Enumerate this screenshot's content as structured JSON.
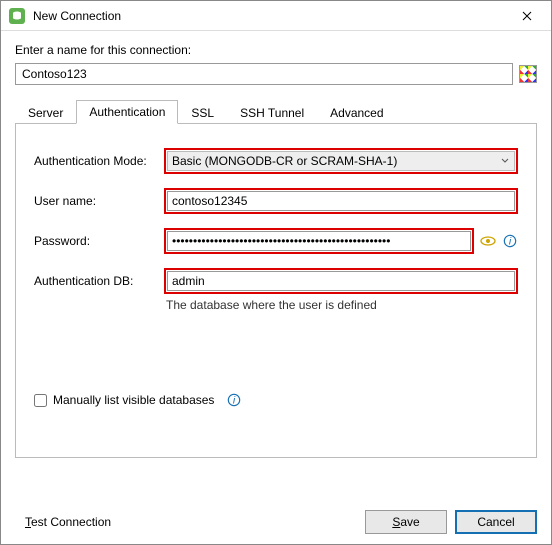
{
  "window": {
    "title": "New Connection"
  },
  "prompt": "Enter a name for this connection:",
  "connection_name": "Contoso123",
  "tabs": {
    "server": "Server",
    "authentication": "Authentication",
    "ssl": "SSL",
    "ssh": "SSH Tunnel",
    "advanced": "Advanced"
  },
  "fields": {
    "auth_mode_label": "Authentication Mode:",
    "auth_mode_value": "Basic (MONGODB-CR or SCRAM-SHA-1)",
    "username_label": "User name:",
    "username_value": "contoso12345",
    "password_label": "Password:",
    "password_value": "••••••••••••••••••••••••••••••••••••••••••••••••••••",
    "authdb_label": "Authentication DB:",
    "authdb_value": "admin",
    "authdb_helper": "The database where the user is defined",
    "manual_label": "Manually list visible databases"
  },
  "buttons": {
    "test": "Test Connection",
    "save": "Save",
    "cancel": "Cancel"
  }
}
